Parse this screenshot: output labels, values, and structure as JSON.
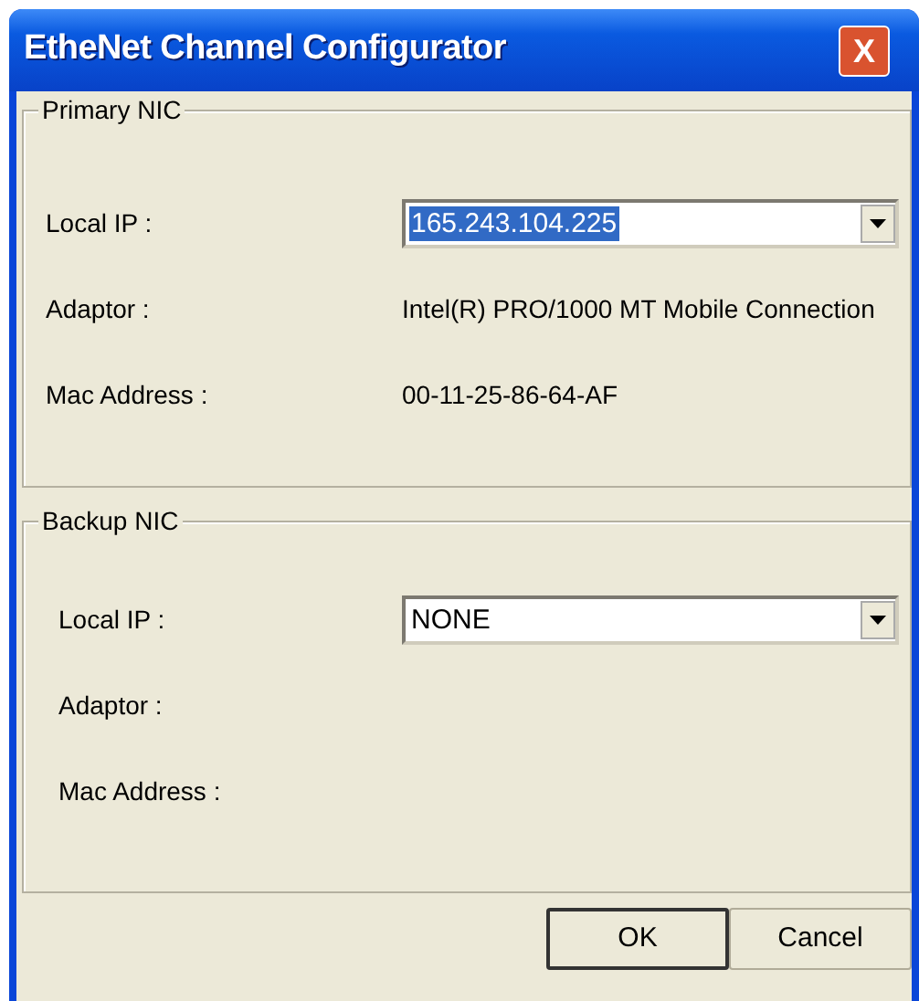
{
  "window": {
    "title": "EtheNet Channel Configurator",
    "close": "X"
  },
  "groups": [
    {
      "title": "Primary NIC",
      "fields": [
        {
          "kind": "combo",
          "label": "Local IP :",
          "value": "165.243.104.225",
          "highlighted": true
        },
        {
          "kind": "text",
          "label": "Adaptor :",
          "value": "Intel(R) PRO/1000 MT Mobile Connection"
        },
        {
          "kind": "text",
          "label": "Mac Address :",
          "value": "00-11-25-86-64-AF"
        }
      ]
    },
    {
      "title": "Backup NIC",
      "fields": [
        {
          "kind": "combo",
          "label": "Local IP :",
          "value": "NONE",
          "highlighted": false
        },
        {
          "kind": "text",
          "label": "Adaptor :"
        },
        {
          "kind": "text",
          "label": "Mac Address :"
        }
      ]
    }
  ],
  "buttons": [
    {
      "label": "OK",
      "default": true
    },
    {
      "label": "Cancel",
      "default": false
    }
  ]
}
